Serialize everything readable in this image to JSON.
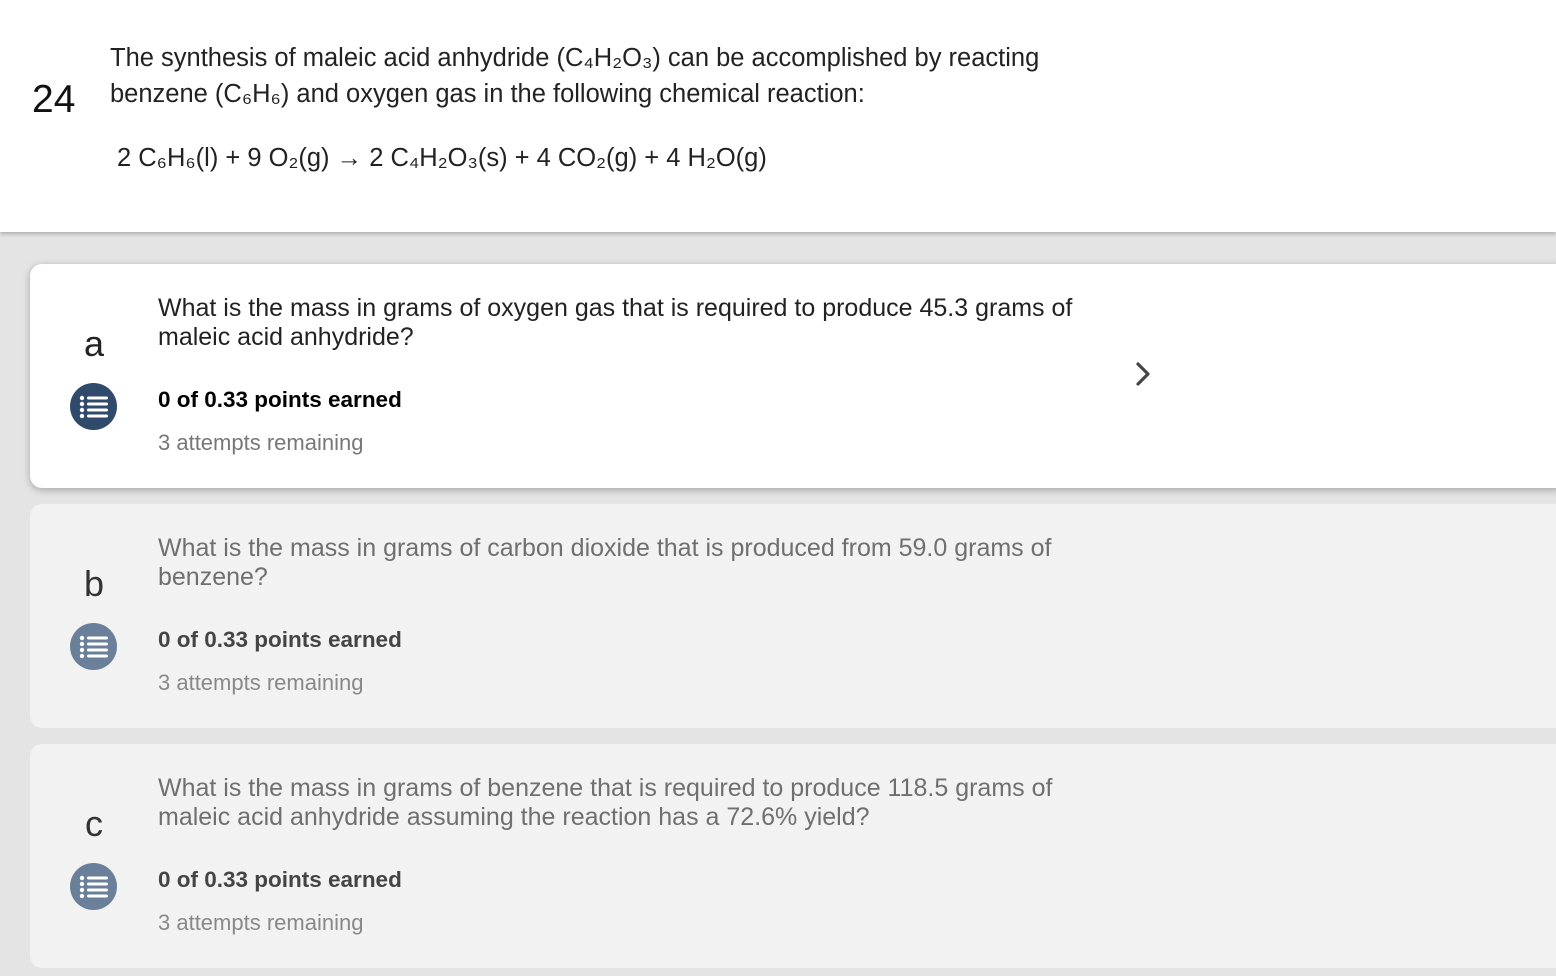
{
  "question": {
    "number": "24",
    "intro": "The synthesis of maleic acid anhydride (C₄H₂O₃) can be accomplished by reacting benzene (C₆H₆) and oxygen gas in the following chemical reaction:",
    "equation": "2 C₆H₆(l) + 9 O₂(g) → 2 C₄H₂O₃(s) + 4 CO₂(g) + 4 H₂O(g)"
  },
  "parts": [
    {
      "letter": "a",
      "prompt": "What is the mass in grams of oxygen gas that is required to produce 45.3 grams of maleic acid anhydride?",
      "points": "0 of 0.33 points earned",
      "attempts": "3 attempts remaining",
      "active": true
    },
    {
      "letter": "b",
      "prompt": "What is the mass in grams of carbon dioxide that is produced from 59.0 grams of benzene?",
      "points": "0 of 0.33 points earned",
      "attempts": "3 attempts remaining",
      "active": false
    },
    {
      "letter": "c",
      "prompt": "What is the mass in grams of benzene that is required to produce 118.5 grams of maleic acid anhydride assuming the reaction has a 72.6% yield?",
      "points": "0 of 0.33 points earned",
      "attempts": "3 attempts remaining",
      "active": false
    }
  ],
  "icons": {
    "list": "list-icon",
    "chevron": "chevron-right-icon"
  },
  "colors": {
    "active_icon_bg": "#2f4a6b",
    "inactive_icon_bg": "#6a7f99"
  }
}
